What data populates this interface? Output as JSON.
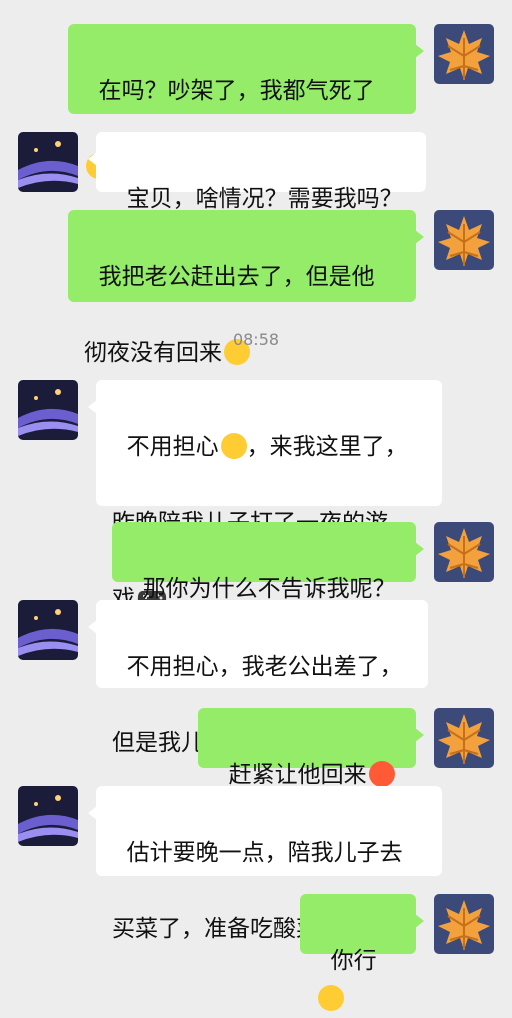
{
  "timestamp": "08:58",
  "messages": [
    {
      "side": "me",
      "lines": [
        "在吗？吵架了，我都气死了"
      ],
      "emoji": "crying-laughing-emoji"
    },
    {
      "side": "them",
      "lines": [
        "宝贝，啥情况？需要我吗？"
      ]
    },
    {
      "side": "me",
      "lines": [
        "我把老公赶出去了，但是他",
        "彻夜没有回来"
      ],
      "emoji": "grinning-sweat-emoji"
    },
    {
      "side": "them",
      "lines": [
        "不用担心",
        "，来我这里了，",
        "昨晚陪我儿子打了一夜的游",
        "戏"
      ],
      "emoji": [
        "grin-emoji",
        "gamepad-emoji"
      ]
    },
    {
      "side": "me",
      "lines": [
        "那你为什么不告诉我呢？"
      ]
    },
    {
      "side": "them",
      "lines": [
        "不用担心，我老公出差了，",
        "但是我儿子在家的"
      ]
    },
    {
      "side": "me",
      "lines": [
        "赶紧让他回来"
      ],
      "emoji": "angry-emoji"
    },
    {
      "side": "them",
      "lines": [
        "估计要晚一点，陪我儿子去",
        "买菜了，准备吃酸菜鱼"
      ],
      "emoji": "grin-emoji"
    },
    {
      "side": "me",
      "lines": [
        "你行"
      ],
      "emoji": "grinning-sweat-emoji"
    }
  ],
  "avatars": {
    "me": "maple-leaf-avatar",
    "them": "night-overpass-avatar"
  },
  "colors": {
    "background": "#ededed",
    "my_bubble": "#95ec69",
    "their_bubble": "#ffffff"
  }
}
